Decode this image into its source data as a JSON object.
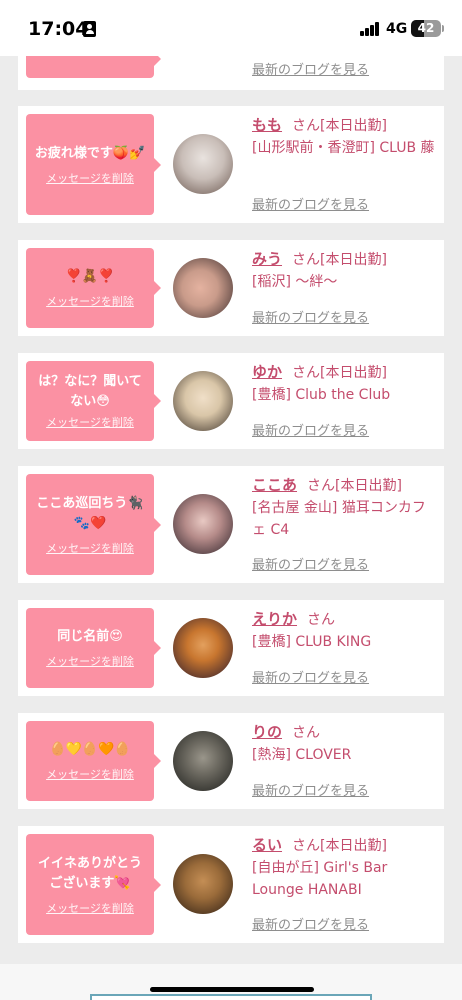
{
  "status_bar": {
    "time": "17:04",
    "network": "4G",
    "battery": "42",
    "battery_level": 0.42
  },
  "delete_label": "メッセージを削除",
  "blog_label": "最新のブログを見る",
  "honorific": "さん",
  "cards": [
    {
      "message": "",
      "name": "",
      "tag": "",
      "shop": "",
      "show_delete": false,
      "avatar_colors": [
        "#ffffff",
        "#ffffff"
      ]
    },
    {
      "message": "お疲れ様です🍑💅",
      "name": "もも",
      "tag": "[本日出勤]",
      "shop": "[山形駅前・香澄町] CLUB 藤",
      "show_delete": true,
      "avatar_colors": [
        "#e9e3df",
        "#6b5850"
      ]
    },
    {
      "message": "❣️🧸❣️",
      "name": "みう",
      "tag": "[本日出勤]",
      "shop": "[稲沢] 〜絆〜",
      "show_delete": true,
      "avatar_colors": [
        "#c99b8a",
        "#3e2f2f"
      ]
    },
    {
      "message": "は？なに？聞いてない😳",
      "name": "ゆか",
      "tag": "[本日出勤]",
      "shop": "[豊橋] Club the Club",
      "show_delete": true,
      "avatar_colors": [
        "#d9c6a8",
        "#3a3028"
      ]
    },
    {
      "message": "ここあ巡回ちう🐈‍⬛🐾❤️",
      "name": "ここあ",
      "tag": "[本日出勤]",
      "shop": "[名古屋 金山] 猫耳コンカフェ C4",
      "show_delete": true,
      "avatar_colors": [
        "#b58b89",
        "#2c2229"
      ]
    },
    {
      "message": "同じ名前😍",
      "name": "えりか",
      "tag": "",
      "shop": "[豊橋] CLUB KING",
      "show_delete": true,
      "avatar_colors": [
        "#c8762f",
        "#2a1a2c"
      ]
    },
    {
      "message": "🥚💛🥚🧡🥚",
      "name": "りの",
      "tag": "",
      "shop": "[熱海] CLOVER",
      "show_delete": true,
      "avatar_colors": [
        "#6e6b62",
        "#1d1e1b"
      ]
    },
    {
      "message": "イイネありがとうございます💘",
      "name": "るい",
      "tag": "[本日出勤]",
      "shop": "[自由が丘] Girl's Bar Lounge HANABI",
      "show_delete": true,
      "avatar_colors": [
        "#9a6b3a",
        "#2b1d14"
      ]
    }
  ]
}
